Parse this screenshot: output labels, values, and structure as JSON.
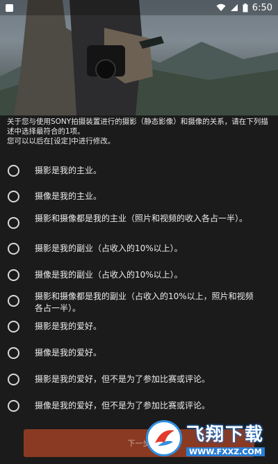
{
  "status_bar": {
    "time": "6:50",
    "icons": [
      "app-icon",
      "wifi-icon",
      "signal-icon",
      "battery-icon"
    ]
  },
  "intro": {
    "line1": "关于您与使用SONY拍摄装置进行的摄影（静态影像）和摄像的关系，请在下列描述中选择最符合的1项。",
    "line2": "您可以以后在[设定]中进行修改。"
  },
  "options": [
    {
      "label": "摄影是我的主业。",
      "selected": false
    },
    {
      "label": "摄像是我的主业。",
      "selected": false
    },
    {
      "label": "摄影和摄像都是我的主业（照片和视频的收入各占一半）。",
      "selected": false
    },
    {
      "label": "摄影是我的副业（占收入的10%以上）。",
      "selected": false
    },
    {
      "label": "摄像是我的副业（占收入的10%以上）。",
      "selected": false
    },
    {
      "label": "摄影和摄像都是我的副业（占收入的10%以上，照片和视频各占一半）。",
      "selected": false
    },
    {
      "label": "摄影是我的爱好。",
      "selected": false
    },
    {
      "label": "摄像是我的爱好。",
      "selected": false
    },
    {
      "label": "摄影是我的爱好，但不是为了参加比赛或评论。",
      "selected": false
    },
    {
      "label": "摄像是我的爱好，但不是为了参加比赛或评论。",
      "selected": false
    }
  ],
  "next_button": {
    "label": "下一步"
  },
  "watermark": {
    "brand": "飞翔下载",
    "url": "WWW.FXXZ.COM"
  },
  "colors": {
    "background": "#1b1b1b",
    "next_button": "#8a3a22",
    "watermark_blue": "#2a7fd4"
  }
}
